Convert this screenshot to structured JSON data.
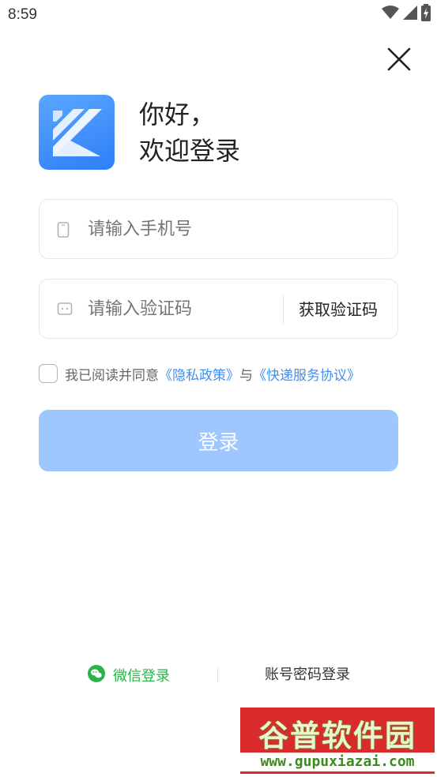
{
  "status_bar": {
    "time": "8:59",
    "icons": [
      "wifi-icon",
      "signal-icon",
      "battery-charging-icon"
    ]
  },
  "header": {
    "close_icon": "close-icon",
    "greeting_line1": "你好，",
    "greeting_line2": "欢迎登录"
  },
  "form": {
    "phone": {
      "placeholder": "请输入手机号",
      "icon": "phone-icon"
    },
    "code": {
      "placeholder": "请输入验证码",
      "icon": "message-icon",
      "get_code_label": "获取验证码"
    },
    "agreement": {
      "prefix": "我已阅读并同意",
      "privacy_link": "《隐私政策》",
      "connector": "与",
      "service_link": "《快递服务协议》",
      "checked": false
    },
    "login_label": "登录"
  },
  "alt_login": {
    "wechat_label": "微信登录",
    "password_label": "账号密码登录"
  },
  "watermark": {
    "title": "谷普软件园",
    "url": "www.gupuxiazai.com"
  },
  "colors": {
    "brand_blue": "#2e7ef7",
    "link_blue": "#3f8ff0",
    "login_disabled": "#9ec6ff",
    "wechat_green": "#2bb24c"
  }
}
